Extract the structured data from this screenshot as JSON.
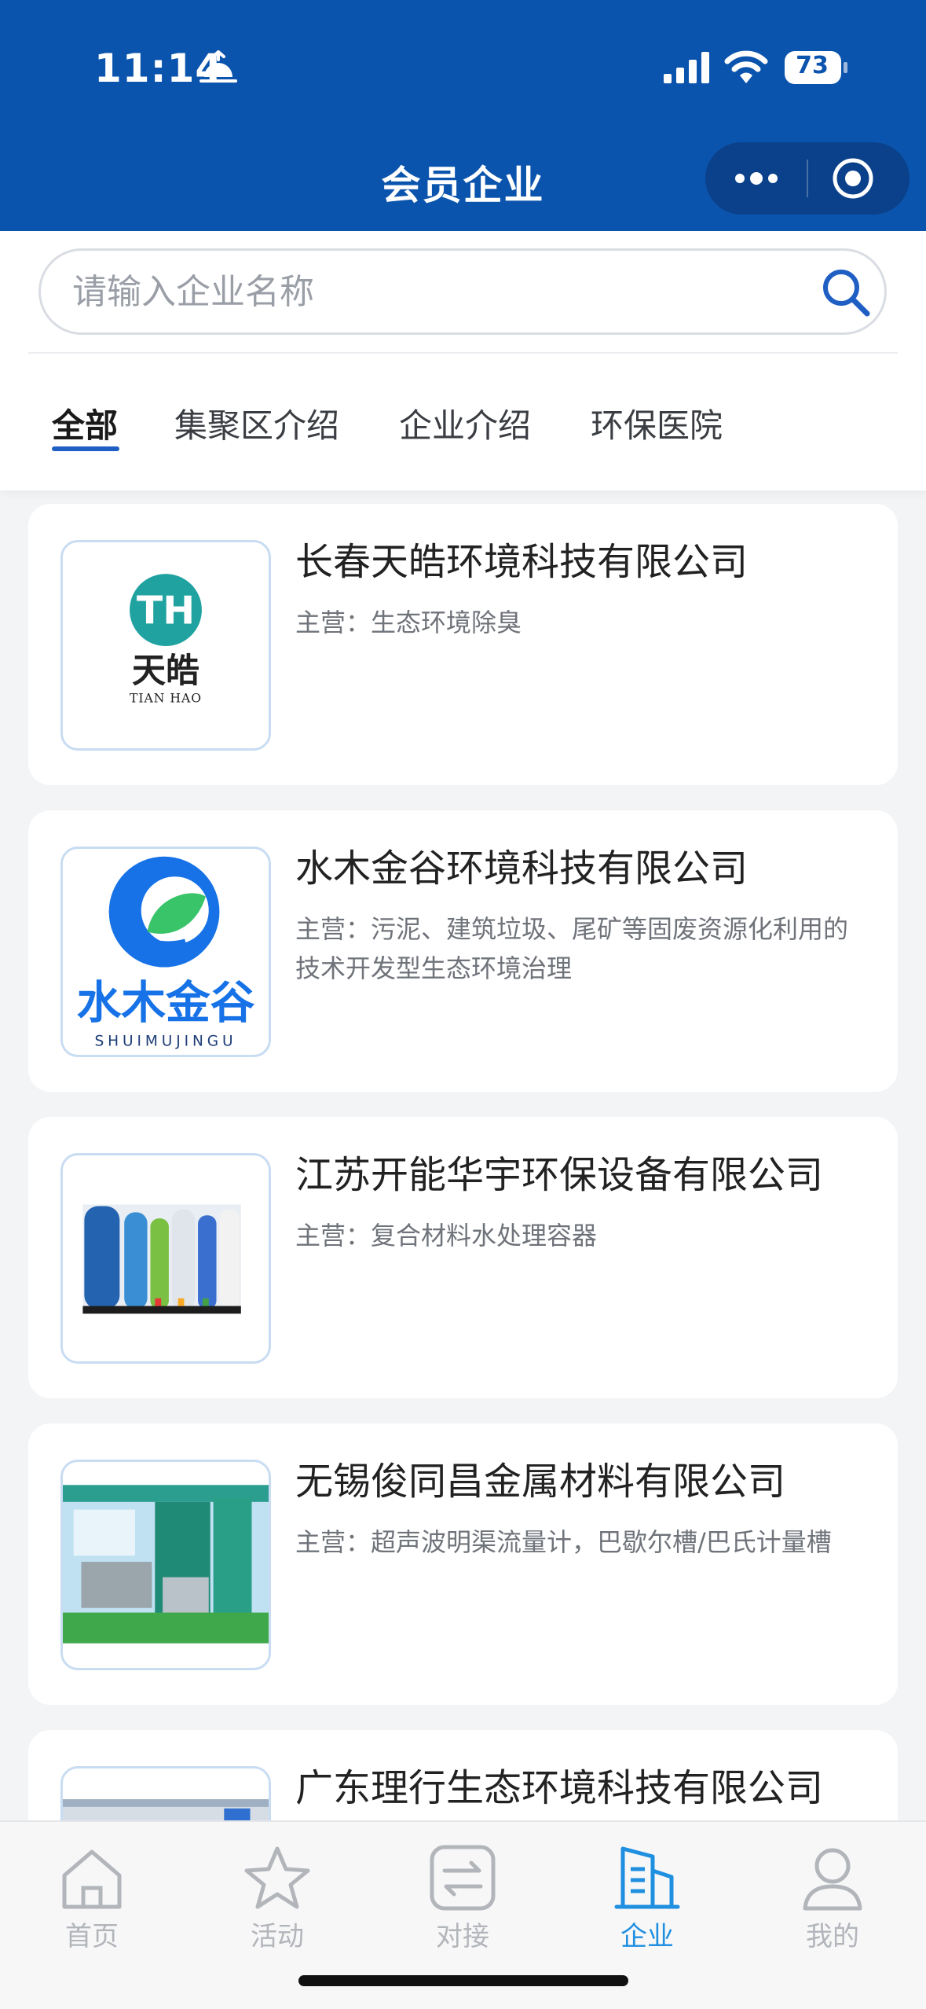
{
  "status_bar": {
    "time": "11:14",
    "battery": "73",
    "icons": [
      "alarm-icon",
      "signal-icon",
      "wifi-icon",
      "battery-icon"
    ]
  },
  "header": {
    "title": "会员企业",
    "capsule_icons": [
      "more-dots-icon",
      "close-target-icon"
    ]
  },
  "search": {
    "placeholder": "请输入企业名称",
    "icon": "search-icon"
  },
  "tabs": [
    {
      "label": "全部",
      "active": true
    },
    {
      "label": "集聚区介绍",
      "active": false
    },
    {
      "label": "企业介绍",
      "active": false
    },
    {
      "label": "环保医院",
      "active": false
    }
  ],
  "companies": [
    {
      "name": "长春天皓环境科技有限公司",
      "desc": "主营：生态环境除臭",
      "logo": {
        "type": "tianhao-logo",
        "monogram": "TH",
        "cn": "天皓",
        "en": "TIAN HAO"
      }
    },
    {
      "name": "水木金谷环境科技有限公司",
      "desc": "主营：污泥、建筑垃圾、尾矿等固废资源化利用的技术开发型生态环境治理",
      "logo": {
        "type": "shuimujingu-logo",
        "cn": "水木金谷",
        "en": "SHUIMUJINGU"
      }
    },
    {
      "name": "江苏开能华宇环保设备有限公司",
      "desc": "主营：复合材料水处理容器",
      "logo": {
        "type": "water-tanks-photo"
      }
    },
    {
      "name": "无锡俊同昌金属材料有限公司",
      "desc": "主营：超声波明渠流量计，巴歇尔槽/巴氏计量槽",
      "logo": {
        "type": "exhibition-booth-photo"
      }
    },
    {
      "name": "广东理行生态环境科技有限公司",
      "desc": "",
      "logo": {
        "type": "partial-photo"
      }
    }
  ],
  "tabbar": [
    {
      "label": "首页",
      "icon": "home-icon",
      "active": false
    },
    {
      "label": "活动",
      "icon": "star-icon",
      "active": false
    },
    {
      "label": "对接",
      "icon": "exchange-icon",
      "active": false
    },
    {
      "label": "企业",
      "icon": "building-icon",
      "active": true
    },
    {
      "label": "我的",
      "icon": "user-icon",
      "active": false
    }
  ],
  "colors": {
    "header_bg": "#0b54ad",
    "accent": "#1f5fc4",
    "tabbar_active": "#1f8fe0"
  }
}
